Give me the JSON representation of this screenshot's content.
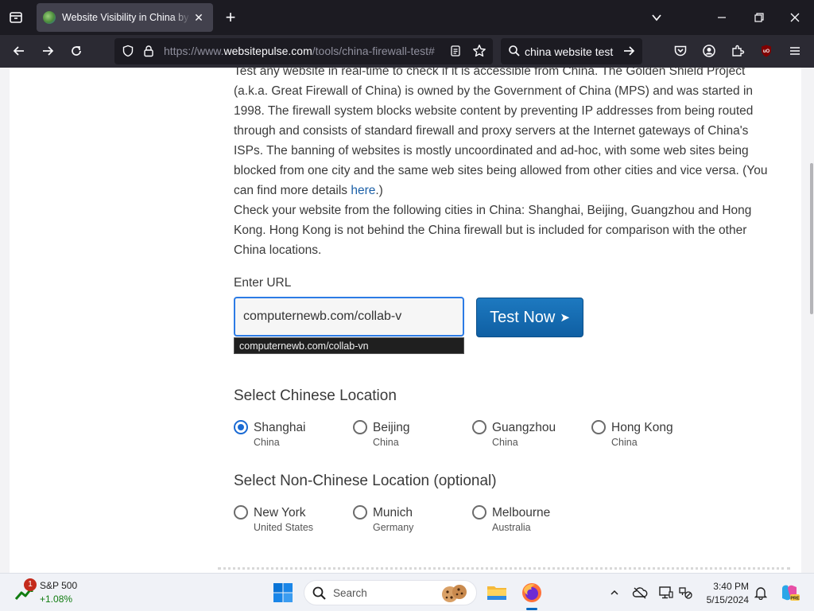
{
  "browser": {
    "tab": {
      "title": "Website Visibility in China by WebSitePulse",
      "close_glyph": "✕"
    },
    "new_tab_glyph": "+",
    "url": {
      "prefix": "https://www.",
      "domain": "websitepulse.com",
      "path": "/tools/china-firewall-test#"
    },
    "search_query": "china website test"
  },
  "page": {
    "intro_text": "Test any website in real-time to check if it is accessible from China. The Golden Shield Project (a.k.a. Great Firewall of China) is owned by the Government of China (MPS) and was started in 1998. The firewall system blocks website content by preventing IP addresses from being routed through and consists of standard firewall and proxy servers at the Internet gateways of China's ISPs. The banning of websites is mostly uncoordinated and ad-hoc, with some web sites being blocked from one city and the same web sites being allowed from other cities and vice versa. (You can find more details ",
    "intro_link": "here",
    "intro_end": ".)",
    "cities_text": "Check your website from the following cities in China: Shanghai, Beijing, Guangzhou and Hong Kong. Hong Kong is not behind the China firewall but is included for comparison with the other China locations.",
    "enter_url_label": "Enter URL",
    "url_value": "computernewb.com/collab-v",
    "autocomplete_suggestion": "computernewb.com/collab-vn",
    "test_button": "Test Now",
    "test_button_arrow": "➤",
    "china_section_title": "Select Chinese Location",
    "china_locations": [
      {
        "name": "Shanghai",
        "country": "China",
        "checked": true
      },
      {
        "name": "Beijing",
        "country": "China",
        "checked": false
      },
      {
        "name": "Guangzhou",
        "country": "China",
        "checked": false
      },
      {
        "name": "Hong Kong",
        "country": "China",
        "checked": false
      }
    ],
    "nonchina_section_title": "Select Non-Chinese Location (optional)",
    "nonchina_locations": [
      {
        "name": "New York",
        "country": "United States",
        "checked": false
      },
      {
        "name": "Munich",
        "country": "Germany",
        "checked": false
      },
      {
        "name": "Melbourne",
        "country": "Australia",
        "checked": false
      }
    ]
  },
  "taskbar": {
    "widget_badge": "1",
    "widget_name": "S&P 500",
    "widget_change": "+1.08%",
    "search_placeholder": "Search",
    "clock_time": "3:40 PM",
    "clock_date": "5/15/2024"
  },
  "colors": {
    "accent": "#1a6ad3",
    "button": "#1d79c0",
    "link": "#1b5fa6",
    "browser_dark": "#1c1b22",
    "positive": "#107c10"
  }
}
